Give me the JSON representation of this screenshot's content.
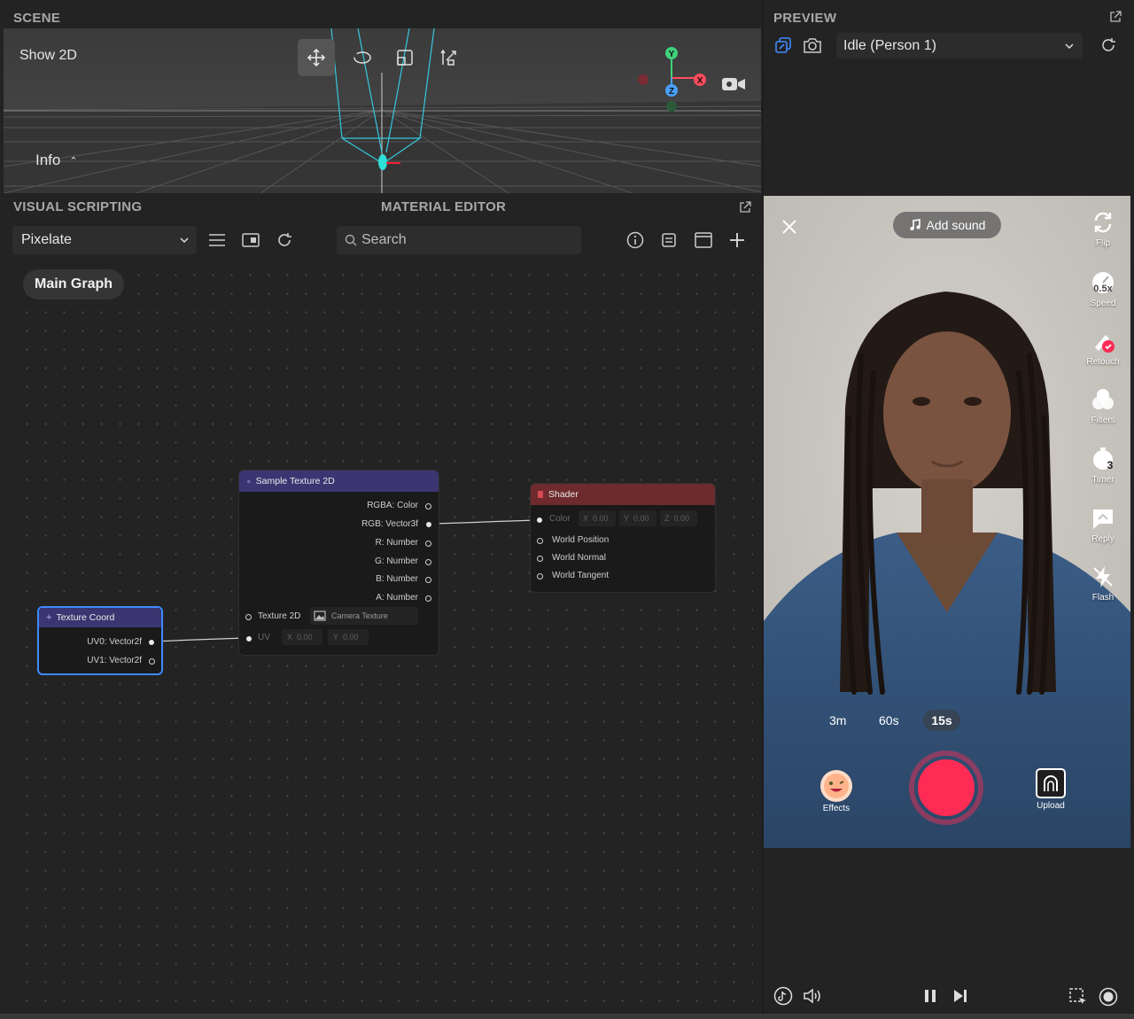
{
  "scene": {
    "title": "SCENE",
    "show2d_label": "Show 2D",
    "info_label": "Info",
    "gizmo": {
      "y": "Y",
      "x": "X",
      "z": "Z"
    }
  },
  "preview": {
    "title": "PREVIEW",
    "state_select": "Idle (Person 1)"
  },
  "visual_scripting": {
    "title": "VISUAL SCRIPTING",
    "material_editor_title": "MATERIAL EDITOR",
    "graph_select": "Pixelate",
    "search_placeholder": "Search",
    "main_graph_label": "Main Graph",
    "nodes": {
      "sample_texture": {
        "title": "Sample Texture 2D",
        "outputs": [
          "RGBA: Color",
          "RGB: Vector3f",
          "R: Number",
          "G: Number",
          "B: Number",
          "A: Number"
        ],
        "texture_label": "Texture 2D",
        "texture_value": "Camera Texture",
        "uv_label": "UV",
        "uv_x_label": "X",
        "uv_x": "0.00",
        "uv_y_label": "Y",
        "uv_y": "0.00"
      },
      "shader": {
        "title": "Shader",
        "color_label": "Color",
        "color_x_label": "X",
        "color_x": "0.00",
        "color_y_label": "Y",
        "color_y": "0.00",
        "color_z_label": "Z",
        "color_z": "0.00",
        "inputs": [
          "World Position",
          "World Normal",
          "World Tangent"
        ]
      },
      "texture_coord": {
        "title": "Texture Coord",
        "outputs": [
          "UV0: Vector2f",
          "UV1: Vector2f"
        ]
      }
    }
  },
  "phone": {
    "add_sound": "Add sound",
    "side_tools": [
      {
        "icon": "flip-icon",
        "label": "Flip"
      },
      {
        "icon": "speed-icon",
        "label": "Speed",
        "badge": "0.5x"
      },
      {
        "icon": "retouch-icon",
        "label": "Retouch"
      },
      {
        "icon": "filters-icon",
        "label": "Filters"
      },
      {
        "icon": "timer-icon",
        "label": "Timer",
        "badge": "3"
      },
      {
        "icon": "reply-icon",
        "label": "Reply"
      },
      {
        "icon": "flash-icon",
        "label": "Flash"
      }
    ],
    "durations": [
      "3m",
      "60s",
      "15s"
    ],
    "effects_label": "Effects",
    "upload_label": "Upload",
    "record_color": "#fe2c55"
  },
  "colors": {
    "accent_blue": "#3d8bfd",
    "node_purple": "#3b3672",
    "node_red": "#6e2a2c"
  }
}
